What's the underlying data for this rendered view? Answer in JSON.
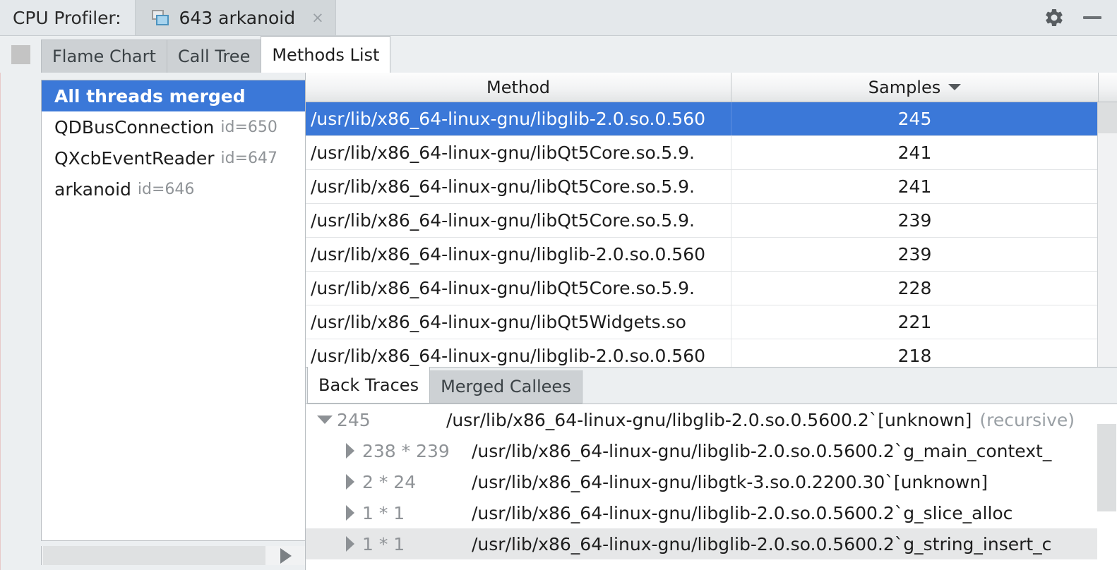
{
  "titlebar": {
    "label": "CPU Profiler:",
    "document_tab": {
      "title": "643 arkanoid",
      "icon": "windows-cascade-icon",
      "close_label": "×"
    },
    "settings_icon": "gear-icon",
    "minimize_label": "minimize-icon"
  },
  "toolbar": {
    "stop_button": "stop-square-button"
  },
  "tabs": [
    {
      "label": "Flame Chart",
      "active": false
    },
    {
      "label": "Call Tree",
      "active": false
    },
    {
      "label": "Methods List",
      "active": true
    }
  ],
  "threads": [
    {
      "name": "All threads merged",
      "id": "",
      "selected": true
    },
    {
      "name": "QDBusConnection",
      "id": "id=650",
      "selected": false
    },
    {
      "name": "QXcbEventReader",
      "id": "id=647",
      "selected": false
    },
    {
      "name": "arkanoid",
      "id": "id=646",
      "selected": false
    }
  ],
  "table": {
    "columns": [
      {
        "label": "Method",
        "sorted": false
      },
      {
        "label": "Samples",
        "sorted": true,
        "sort_direction": "desc"
      }
    ],
    "rows": [
      {
        "method": "/usr/lib/x86_64-linux-gnu/libglib-2.0.so.0.560",
        "samples": "245",
        "selected": true
      },
      {
        "method": "/usr/lib/x86_64-linux-gnu/libQt5Core.so.5.9.",
        "samples": "241",
        "selected": false
      },
      {
        "method": "/usr/lib/x86_64-linux-gnu/libQt5Core.so.5.9.",
        "samples": "241",
        "selected": false
      },
      {
        "method": "/usr/lib/x86_64-linux-gnu/libQt5Core.so.5.9.",
        "samples": "239",
        "selected": false
      },
      {
        "method": "/usr/lib/x86_64-linux-gnu/libglib-2.0.so.0.560",
        "samples": "239",
        "selected": false
      },
      {
        "method": "/usr/lib/x86_64-linux-gnu/libQt5Core.so.5.9.",
        "samples": "228",
        "selected": false
      },
      {
        "method": "/usr/lib/x86_64-linux-gnu/libQt5Widgets.so",
        "samples": "221",
        "selected": false
      },
      {
        "method": "/usr/lib/x86_64-linux-gnu/libglib-2.0.so.0.560",
        "samples": "218",
        "selected": false
      }
    ]
  },
  "bottom_tabs": [
    {
      "label": "Back Traces",
      "active": true
    },
    {
      "label": "Merged Callees",
      "active": false
    }
  ],
  "trace_tree": [
    {
      "expanded": true,
      "indent": 0,
      "count": "245",
      "name": "/usr/lib/x86_64-linux-gnu/libglib-2.0.so.0.5600.2`[unknown]",
      "note": "(recursive)",
      "hovered": false
    },
    {
      "expanded": false,
      "indent": 1,
      "count": "238 * 239",
      "name": "/usr/lib/x86_64-linux-gnu/libglib-2.0.so.0.5600.2`g_main_context_",
      "note": "",
      "hovered": false
    },
    {
      "expanded": false,
      "indent": 1,
      "count": "2 * 24",
      "name": "/usr/lib/x86_64-linux-gnu/libgtk-3.so.0.2200.30`[unknown]",
      "note": "",
      "hovered": false
    },
    {
      "expanded": false,
      "indent": 1,
      "count": "1 * 1",
      "name": "/usr/lib/x86_64-linux-gnu/libglib-2.0.so.0.5600.2`g_slice_alloc",
      "note": "",
      "hovered": false
    },
    {
      "expanded": false,
      "indent": 1,
      "count": "1 * 1",
      "name": "/usr/lib/x86_64-linux-gnu/libglib-2.0.so.0.5600.2`g_string_insert_c",
      "note": "",
      "hovered": true
    }
  ],
  "colors": {
    "selection_blue": "#3b78d8",
    "panel_gray": "#eceff1",
    "tab_inactive": "#cdd1d4",
    "muted_text": "#8f9397"
  }
}
